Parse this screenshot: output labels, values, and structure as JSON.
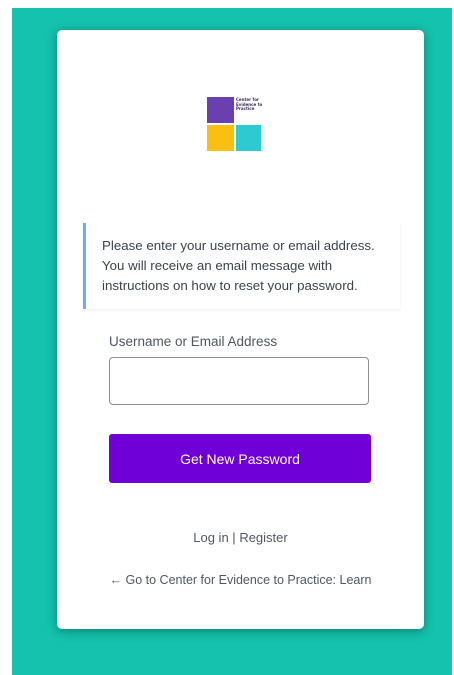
{
  "logo": {
    "text": "Center for Evidence to Practice",
    "colors": {
      "purple": "#6a3fb0",
      "yellow": "#f9c013",
      "cyan": "#2ccad1"
    }
  },
  "notice": {
    "message": "Please enter your username or email address. You will receive an email message with instructions on how to reset your password."
  },
  "form": {
    "field_label": "Username or Email Address",
    "field_value": "",
    "submit_label": "Get New Password"
  },
  "nav": {
    "login_label": "Log in",
    "separator": "|",
    "register_label": "Register"
  },
  "back_link": {
    "label": "← Go to Center for Evidence to Practice: Learn"
  },
  "colors": {
    "background": "#14c2ad",
    "button": "#7000d8",
    "notice_border": "#72aee6"
  }
}
